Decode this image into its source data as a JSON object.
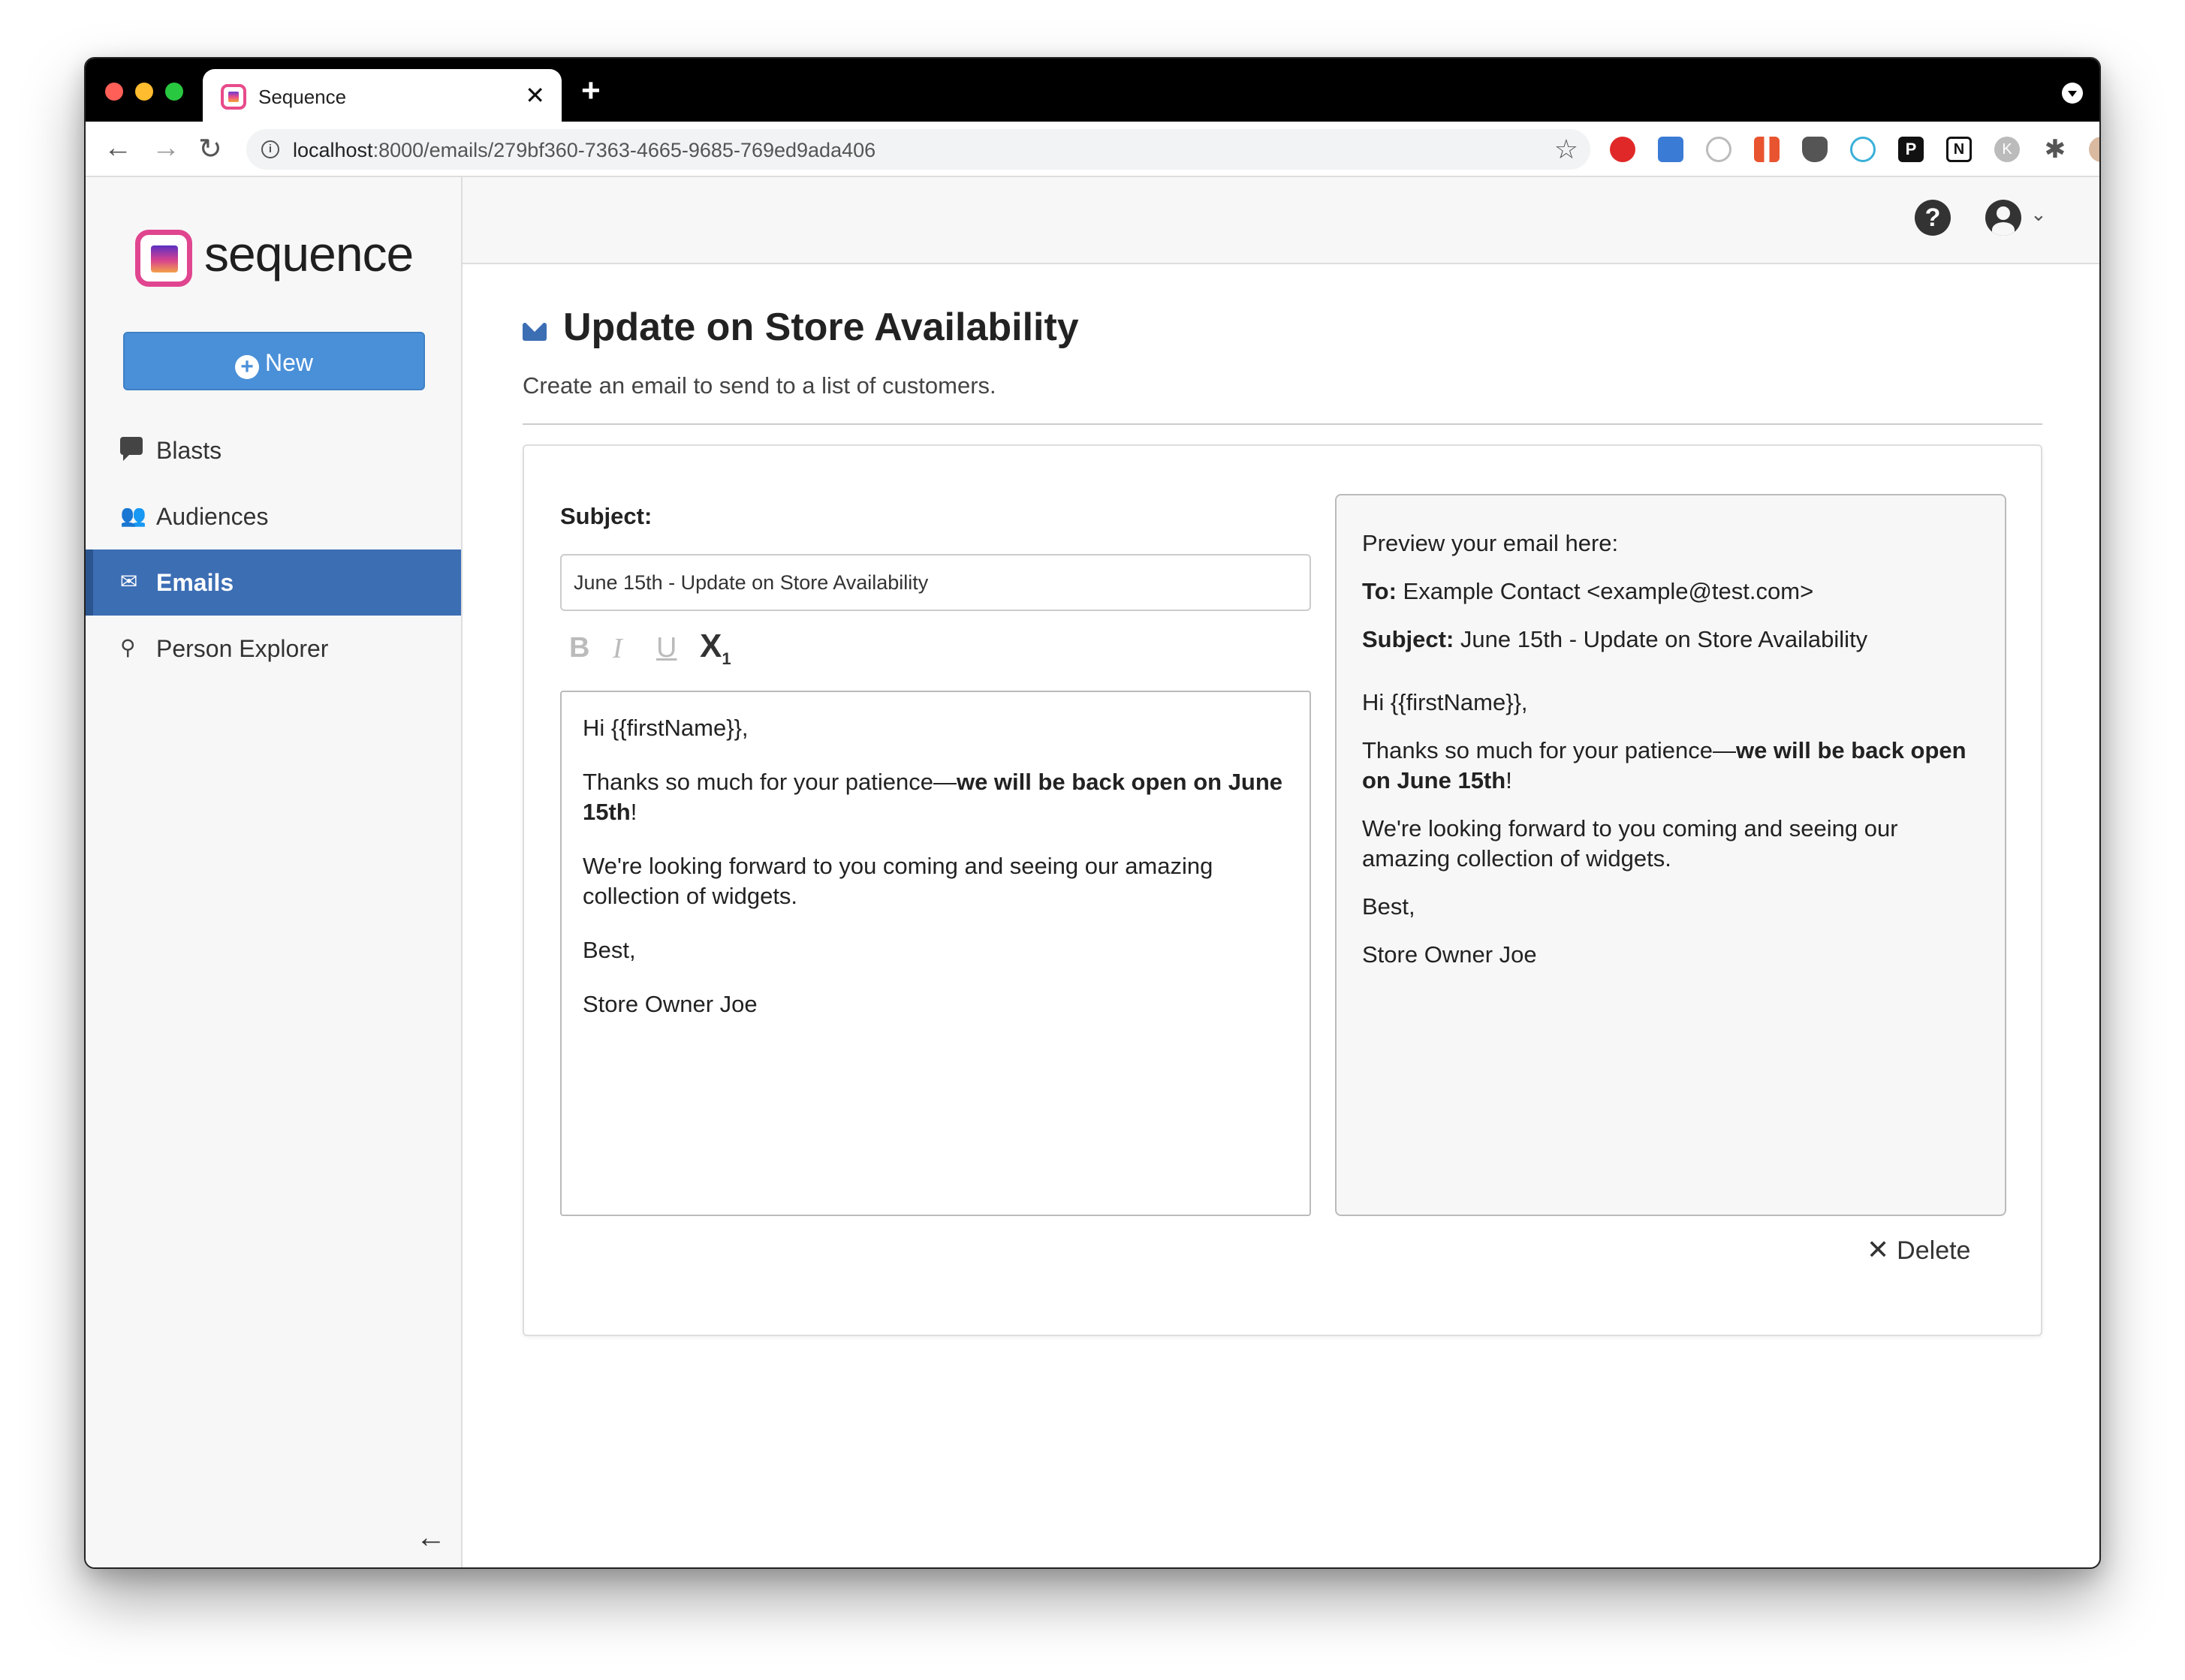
{
  "browser": {
    "tab_title": "Sequence",
    "tab_close": "✕",
    "new_tab": "+",
    "url_host": "localhost",
    "url_rest": ":8000/emails/279bf360-7363-4665-9685-769ed9ada406",
    "ext_p": "P",
    "ext_n": "N",
    "ext_k": "K",
    "ext_puzzle": "✱"
  },
  "sidebar": {
    "logo_text": "sequence",
    "new_button": "New",
    "items": [
      {
        "label": "Blasts",
        "icon": "chat-icon"
      },
      {
        "label": "Audiences",
        "icon": "users-icon"
      },
      {
        "label": "Emails",
        "icon": "envelope-icon",
        "active": true
      },
      {
        "label": "Person Explorer",
        "icon": "search-icon"
      }
    ]
  },
  "header": {
    "help_icon": "?",
    "chevron": "⌄"
  },
  "page": {
    "title": "Update on Store Availability",
    "description": "Create an email to send to a list of customers."
  },
  "editor": {
    "subject_label": "Subject:",
    "subject_value": "June 15th - Update on Store Availability",
    "format_bold": "B",
    "format_italic": "I",
    "format_underline": "U",
    "format_sub_x": "X",
    "format_sub_1": "1",
    "greeting": "Hi {{firstName}},",
    "line2_plain": "Thanks so much for your patience—",
    "line2_bold": "we will be back open on June 15th",
    "line2_end": "!",
    "line3": "We're looking forward to you coming and seeing our amazing collection of widgets.",
    "line4": "Best,",
    "line5": "Store Owner Joe"
  },
  "preview": {
    "heading": "Preview your email here:",
    "to_label": "To:",
    "to_value": " Example Contact <example@test.com>",
    "subject_label": "Subject:",
    "subject_value": " June 15th - Update on Store Availability"
  },
  "actions": {
    "delete_label": "Delete",
    "delete_icon": "✕"
  },
  "colors": {
    "accent": "#4a90d9",
    "active_nav": "#3c6eb4"
  }
}
